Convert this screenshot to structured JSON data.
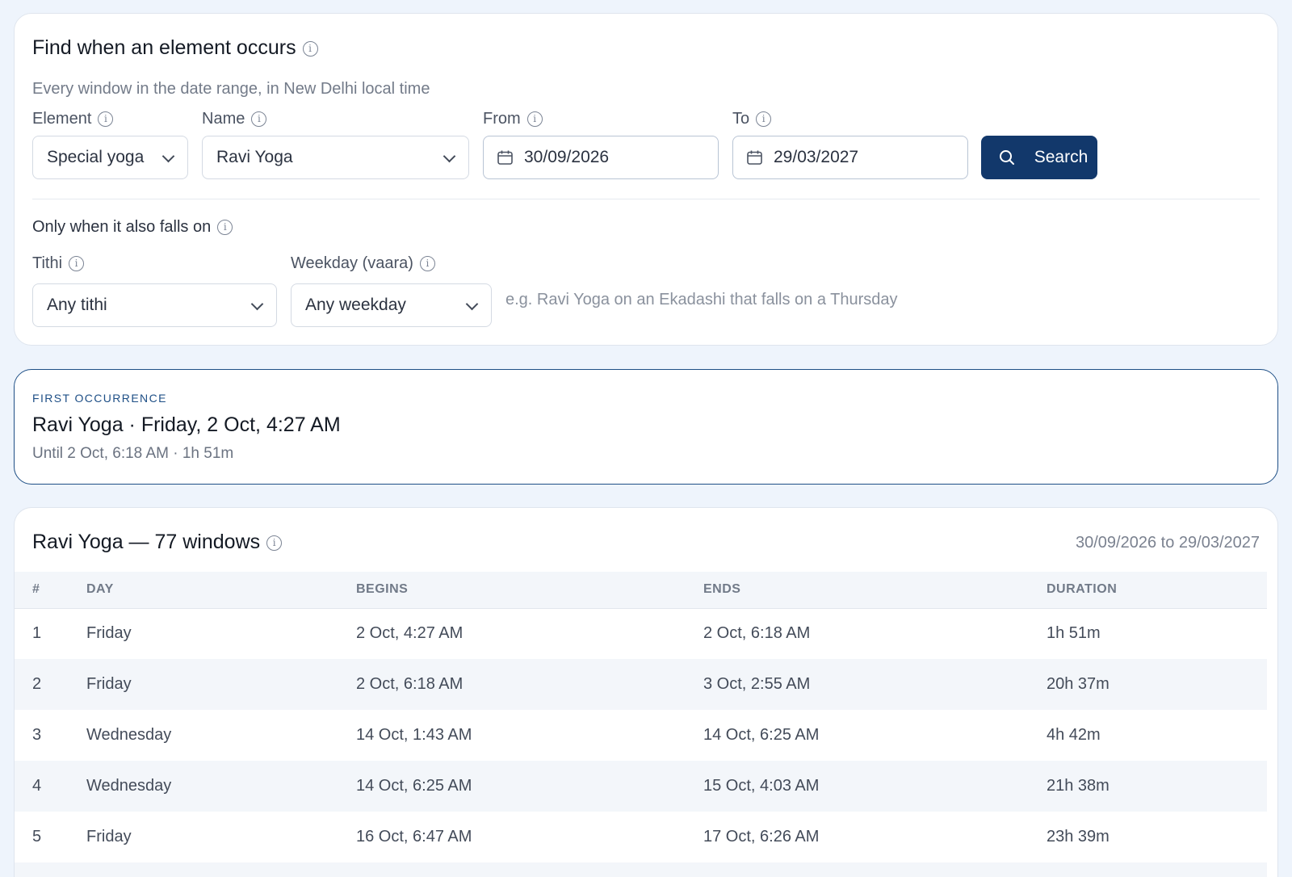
{
  "search": {
    "title": "Find when an element occurs",
    "subtitle": "Every window in the date range, in New Delhi local time",
    "element_label": "Element",
    "element_value": "Special yoga",
    "name_label": "Name",
    "name_value": "Ravi Yoga",
    "from_label": "From",
    "from_value": "30/09/2026",
    "to_label": "To",
    "to_value": "29/03/2027",
    "search_button": "Search",
    "filter_heading": "Only when it also falls on",
    "tithi_label": "Tithi",
    "tithi_value": "Any tithi",
    "weekday_label": "Weekday (vaara)",
    "weekday_value": "Any weekday",
    "hint": "e.g. Ravi Yoga on an Ekadashi that falls on a Thursday"
  },
  "first_occurrence": {
    "label": "FIRST OCCURRENCE",
    "main": "Ravi Yoga · Friday, 2 Oct, 4:27 AM",
    "sub": "Until 2 Oct, 6:18 AM · 1h 51m"
  },
  "results": {
    "title": "Ravi Yoga — 77 windows",
    "range": "30/09/2026 to 29/03/2027",
    "columns": [
      "#",
      "DAY",
      "BEGINS",
      "ENDS",
      "DURATION"
    ],
    "rows": [
      [
        "1",
        "Friday",
        "2 Oct, 4:27 AM",
        "2 Oct, 6:18 AM",
        "1h 51m"
      ],
      [
        "2",
        "Friday",
        "2 Oct, 6:18 AM",
        "3 Oct, 2:55 AM",
        "20h 37m"
      ],
      [
        "3",
        "Wednesday",
        "14 Oct, 1:43 AM",
        "14 Oct, 6:25 AM",
        "4h 42m"
      ],
      [
        "4",
        "Wednesday",
        "14 Oct, 6:25 AM",
        "15 Oct, 4:03 AM",
        "21h 38m"
      ],
      [
        "5",
        "Friday",
        "16 Oct, 6:47 AM",
        "17 Oct, 6:26 AM",
        "23h 39m"
      ]
    ]
  },
  "icons": {
    "info": "info-icon",
    "chevron": "chevron-down-icon",
    "calendar": "calendar-icon",
    "search": "search-icon"
  },
  "colors": {
    "page_bg": "#eef4fc",
    "accent": "#12386b",
    "accent_border": "#1e4f86"
  }
}
